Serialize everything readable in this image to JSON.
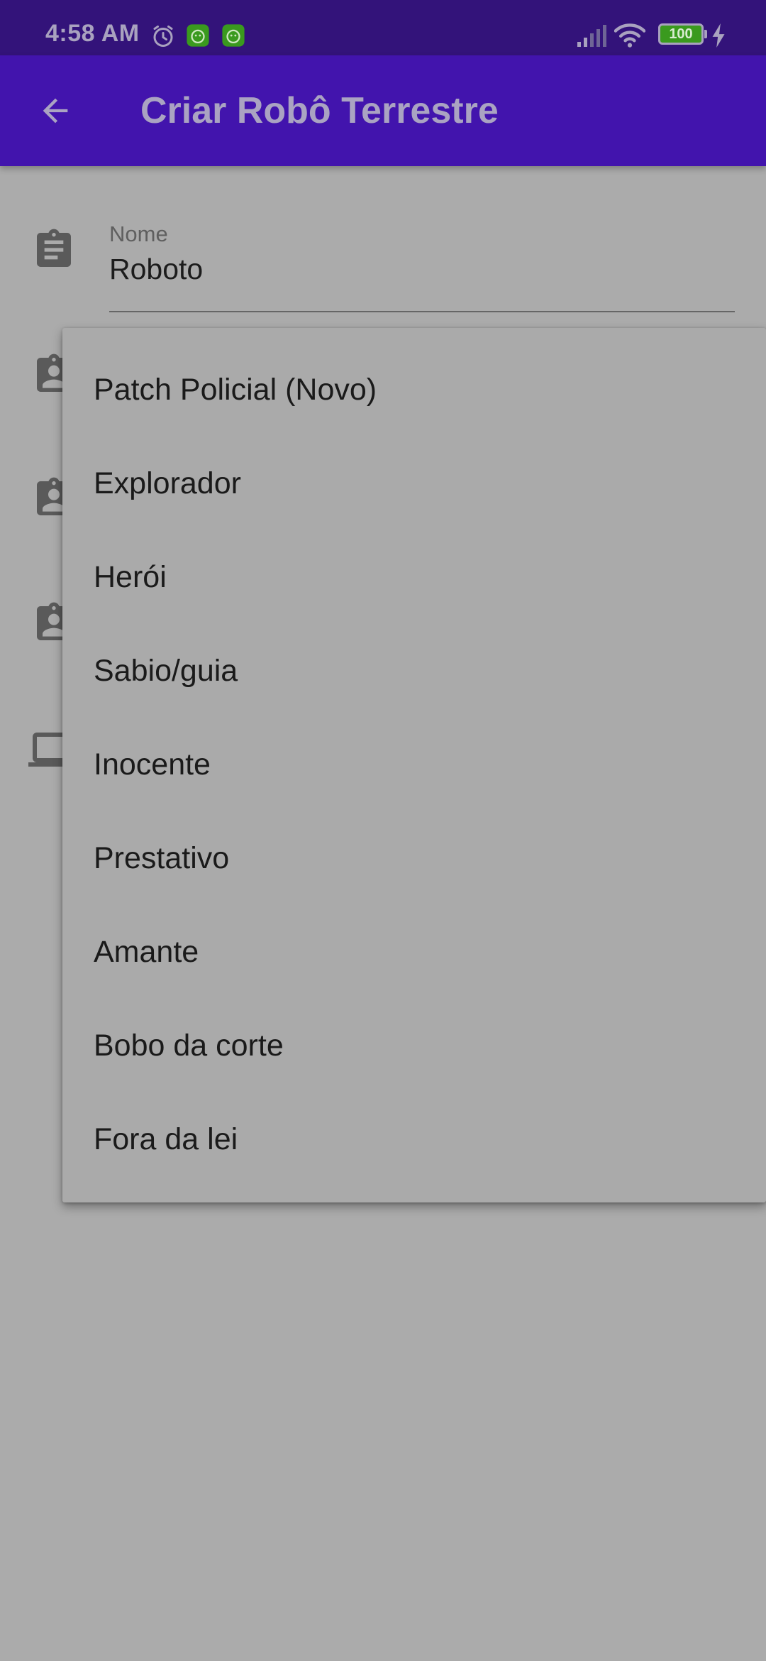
{
  "status_bar": {
    "time": "4:58 AM",
    "battery": "100",
    "icons": [
      "alarm-icon",
      "app-notification-icon",
      "app-notification-icon",
      "signal-icon",
      "wifi-icon",
      "battery-icon",
      "charging-icon"
    ]
  },
  "app_bar": {
    "title": "Criar Robô Terrestre",
    "back_icon": "arrow-back-icon"
  },
  "form": {
    "name_field": {
      "label": "Nome",
      "value": "Roboto"
    },
    "icons": [
      "assignment-icon",
      "assignment-ind-icon",
      "assignment-ind-icon",
      "assignment-ind-icon",
      "laptop-icon"
    ]
  },
  "dropdown": {
    "items": [
      "Patch Policial (Novo)",
      "Explorador",
      "Herói",
      "Sabio/guia",
      "Inocente",
      "Prestativo",
      "Amante",
      "Bobo da corte",
      "Fora da lei"
    ]
  },
  "colors": {
    "status_bar": "#33137a",
    "app_bar": "#4214ad",
    "scrim_background": "#ababab",
    "menu_background": "#aaaaaa"
  }
}
